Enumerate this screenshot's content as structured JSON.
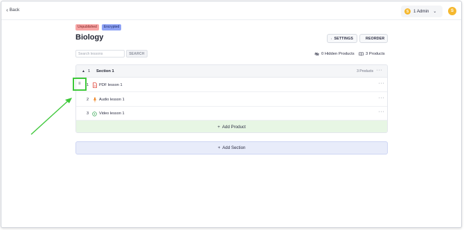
{
  "header": {
    "back_label": "Back",
    "admin_coin": "S",
    "admin_label": "1 Admin",
    "avatar_initial": "S"
  },
  "badges": {
    "unpublished": "Unpublished",
    "encrypted": "Encrypted"
  },
  "course": {
    "title": "Biology"
  },
  "toolbar": {
    "settings_label": "SETTINGS",
    "reorder_label": "REORDER"
  },
  "search": {
    "placeholder": "Search lessons",
    "button_label": "SEARCH"
  },
  "meta": {
    "hidden_products": "0 Hidden Products",
    "products_count": "3 Products"
  },
  "section": {
    "number": "1",
    "name": "Section 1",
    "products_count": "3 Products",
    "lessons": [
      {
        "number": "1",
        "label": "PDF lesson 1",
        "icon": "pdf-icon"
      },
      {
        "number": "2",
        "label": "Audio lesson 1",
        "icon": "microphone-icon"
      },
      {
        "number": "3",
        "label": "Video lesson 1",
        "icon": "play-icon"
      }
    ],
    "add_product_label": "Add Product"
  },
  "add_section_label": "Add Section",
  "colors": {
    "unpublished_badge": "#f7a4a4",
    "encrypted_badge": "#8fa3f5",
    "add_product_bg": "#e7f6e4",
    "add_section_bg": "#e8ecfa",
    "annotation_green": "#3ec83a",
    "coin_yellow": "#f5b82e"
  }
}
